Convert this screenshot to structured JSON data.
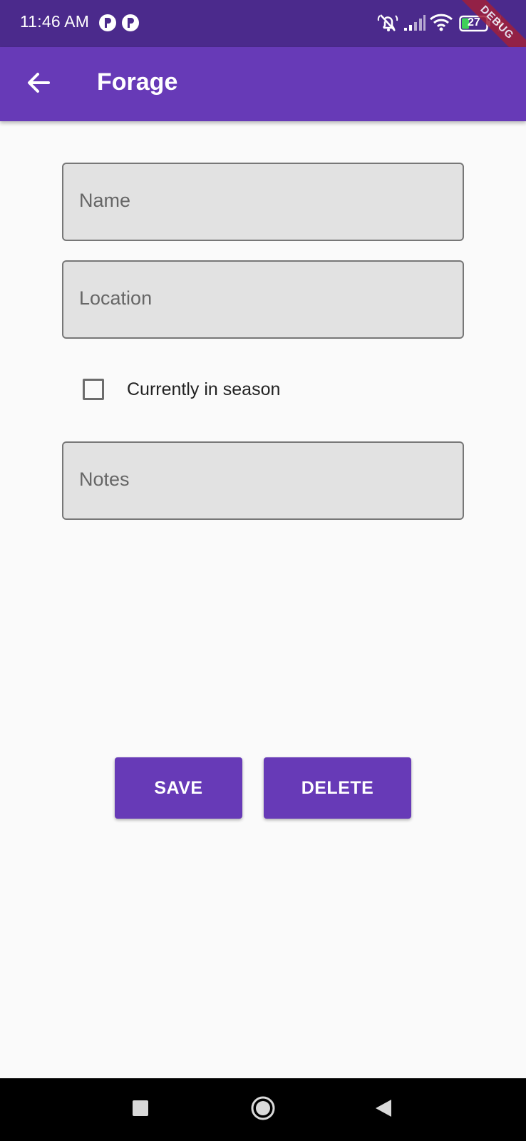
{
  "status_bar": {
    "time": "11:46 AM",
    "battery_level": "27",
    "debug_banner": "DEBUG",
    "icons": [
      "app-notification-icon",
      "app-notification-icon",
      "do-not-disturb-icon",
      "signal-icon",
      "wifi-icon",
      "battery-icon",
      "charging-icon"
    ]
  },
  "app_bar": {
    "title": "Forage",
    "back_icon": "arrow-back-icon"
  },
  "form": {
    "name_placeholder": "Name",
    "location_placeholder": "Location",
    "in_season_label": "Currently in season",
    "in_season_checked": false,
    "notes_placeholder": "Notes"
  },
  "actions": {
    "save_label": "SAVE",
    "delete_label": "DELETE"
  },
  "nav_bar": {
    "icons": [
      "recents-square-icon",
      "home-circle-icon",
      "back-triangle-icon"
    ]
  },
  "colors": {
    "status_bar": "#4b2a8c",
    "primary": "#673ab7",
    "field_fill": "#e2e2e2",
    "field_border": "#777777",
    "background": "#fafafa",
    "debug_ribbon": "#a0203a"
  }
}
